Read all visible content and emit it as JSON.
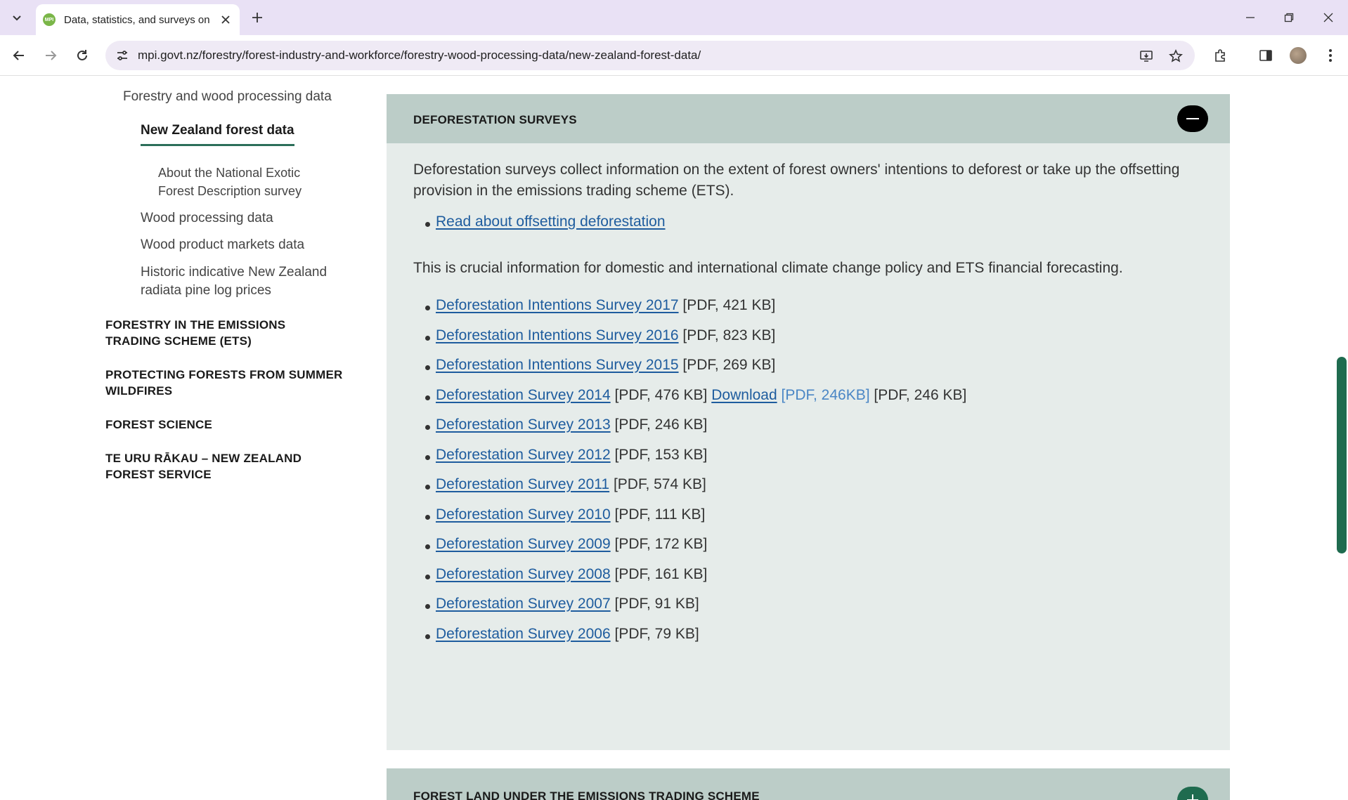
{
  "browser": {
    "tab": {
      "favicon": "MPI",
      "title": "Data, statistics, and surveys on "
    },
    "url": "mpi.govt.nz/forestry/forest-industry-and-workforce/forestry-wood-processing-data/new-zealand-forest-data/"
  },
  "sidebar": {
    "level2": "Forestry and wood processing data",
    "current": "New Zealand forest data",
    "about_survey": "About the National Exotic Forest Description survey",
    "wood_processing": "Wood processing data",
    "wood_markets": "Wood product markets data",
    "log_prices": "Historic indicative New Zealand radiata pine log prices",
    "top_items": [
      "FORESTRY IN THE EMISSIONS TRADING SCHEME (ETS)",
      "PROTECTING FORESTS FROM SUMMER WILDFIRES",
      "FOREST SCIENCE",
      "TE URU RĀKAU – NEW ZEALAND FOREST SERVICE"
    ]
  },
  "section": {
    "title": "DEFORESTATION SURVEYS",
    "intro": "Deforestation surveys collect information on the extent of forest owners' intentions to deforest or take up the offsetting provision in the emissions trading scheme (ETS).",
    "offsetting_link": "Read about offsetting deforestation",
    "importance": "This is crucial information for domestic and international climate change policy and ETS financial forecasting.",
    "surveys": [
      {
        "link": "Deforestation Intentions Survey 2017",
        "meta": "[PDF, 421 KB]"
      },
      {
        "link": "Deforestation Intentions Survey 2016",
        "meta": "[PDF, 823 KB]"
      },
      {
        "link": "Deforestation Intentions Survey 2015",
        "meta": "[PDF, 269 KB]"
      },
      {
        "link": "Deforestation Survey 2014",
        "meta": "[PDF, 476 KB]",
        "extra_link": "Download",
        "extra_meta": "[PDF, 246KB]",
        "meta2": "[PDF, 246 KB]"
      },
      {
        "link": "Deforestation Survey 2013",
        "meta": "[PDF, 246 KB]"
      },
      {
        "link": "Deforestation Survey 2012",
        "meta": "[PDF, 153 KB]"
      },
      {
        "link": "Deforestation Survey 2011",
        "meta": "[PDF, 574 KB]"
      },
      {
        "link": "Deforestation Survey 2010",
        "meta": "[PDF, 111 KB]"
      },
      {
        "link": "Deforestation Survey 2009",
        "meta": "[PDF, 172 KB]"
      },
      {
        "link": "Deforestation Survey 2008",
        "meta": "[PDF, 161 KB]"
      },
      {
        "link": "Deforestation Survey 2007",
        "meta": "[PDF, 91 KB]"
      },
      {
        "link": "Deforestation Survey 2006",
        "meta": "[PDF, 79 KB]"
      }
    ]
  },
  "next_section": {
    "title": "FOREST LAND UNDER THE EMISSIONS TRADING SCHEME"
  },
  "colors": {
    "accent": "#1f6b4f",
    "header_bg": "#bccdc8",
    "panel_bg": "#e6ecea",
    "link": "#1e5c9e"
  }
}
